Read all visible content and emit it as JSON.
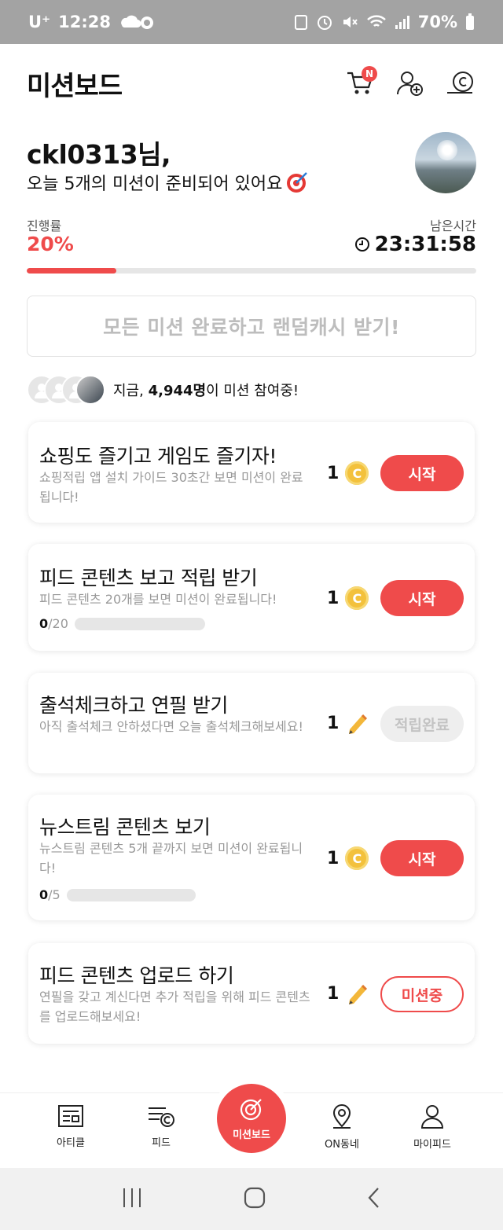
{
  "status_bar": {
    "carrier": "U⁺",
    "time": "12:28",
    "battery": "70%"
  },
  "header": {
    "title": "미션보드",
    "cart_badge": "N"
  },
  "greeting": {
    "name": "ckl0313님,",
    "subtitle": "오늘 5개의 미션이 준비되어 있어요"
  },
  "progress": {
    "label": "진행률",
    "value": "20%",
    "fraction": 0.2,
    "time_label": "남은시간",
    "time_value": "23:31:58"
  },
  "complete_box": {
    "text": "모든 미션 완료하고 랜덤캐시 받기!"
  },
  "participants": {
    "prefix": "지금, ",
    "count": "4,944명",
    "suffix": "이 미션 참여중!"
  },
  "missions": [
    {
      "title": "쇼핑도 즐기고 게임도 즐기자!",
      "desc": "쇼핑적립 앱 설치 가이드 30초간 보면 미션이 완료됩니다!",
      "reward": "1",
      "reward_icon": "coin-icon",
      "button": "시작",
      "status": "start"
    },
    {
      "title": "피드 콘텐츠 보고 적립 받기",
      "desc": "피드 콘텐츠 20개를 보면 미션이 완료됩니다!",
      "reward": "1",
      "reward_icon": "coin-icon",
      "button": "시작",
      "status": "start",
      "progress_done": "0",
      "progress_total": "/20"
    },
    {
      "title": "출석체크하고 연필 받기",
      "desc": "아직 출석체크 안하셨다면 오늘 출석체크해보세요!",
      "reward": "1",
      "reward_icon": "pencil-icon",
      "button": "적립완료",
      "status": "done"
    },
    {
      "title": "뉴스트림 콘텐츠 보기",
      "desc": "뉴스트림 콘텐츠 5개 끝까지 보면 미션이 완료됩니다!",
      "reward": "1",
      "reward_icon": "coin-icon",
      "button": "시작",
      "status": "start",
      "progress_done": "0",
      "progress_total": "/5"
    },
    {
      "title": "피드 콘텐츠 업로드 하기",
      "desc": "연필을 갖고 계신다면 추가 적립을 위해 피드 콘텐츠를 업로드해보세요!",
      "reward": "1",
      "reward_icon": "pencil-icon",
      "button": "미션중",
      "status": "ongoing"
    }
  ],
  "bottom_nav": {
    "article": "아티클",
    "feed": "피드",
    "mission": "미션보드",
    "town": "ON동네",
    "my": "마이피드"
  },
  "colors": {
    "accent": "#ef4b4b",
    "coin": "#f3c13c"
  }
}
